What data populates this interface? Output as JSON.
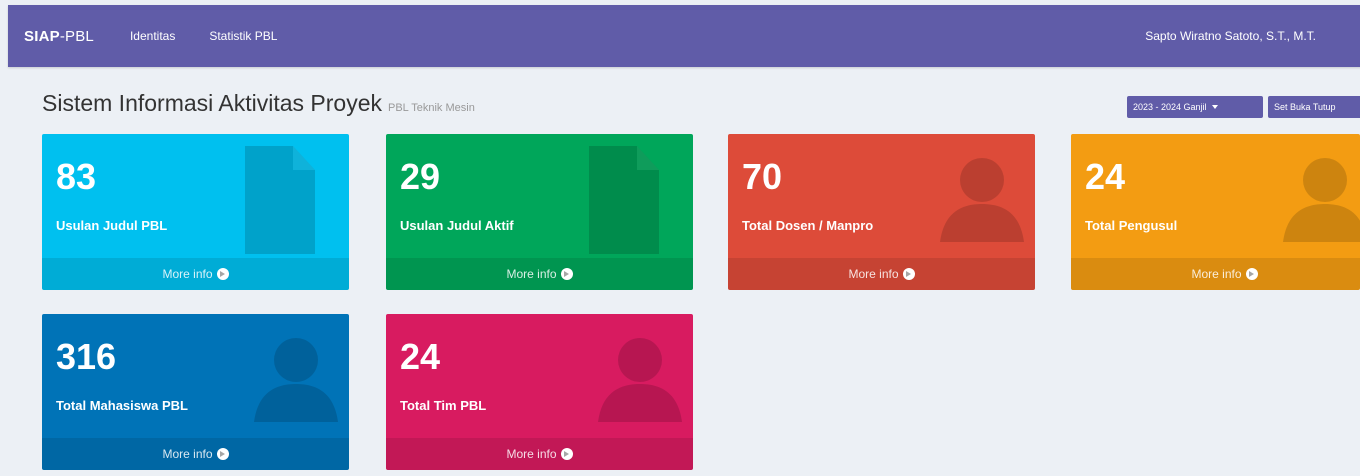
{
  "navbar": {
    "brand_bold": "SIAP",
    "brand_rest": "-PBL",
    "links": [
      "Identitas",
      "Statistik PBL"
    ],
    "user_name": "Sapto Wiratno Satoto, S.T., M.T."
  },
  "header": {
    "title": "Sistem Informasi Aktivitas Proyek",
    "subtitle": "PBL Teknik Mesin",
    "period_button": "2023 - 2024 Ganjil",
    "set_button": "Set Buka Tutup"
  },
  "boxes": [
    {
      "number": "83",
      "label": "Usulan Judul PBL",
      "more": "More info",
      "icon": "document-icon",
      "color": "#00c0ef"
    },
    {
      "number": "29",
      "label": "Usulan Judul Aktif",
      "more": "More info",
      "icon": "document-icon",
      "color": "#00a65a"
    },
    {
      "number": "70",
      "label": "Total Dosen / Manpro",
      "more": "More info",
      "icon": "user-icon",
      "color": "#dd4b39"
    },
    {
      "number": "24",
      "label": "Total Pengusul",
      "more": "More info",
      "icon": "user-icon",
      "color": "#f39c12"
    },
    {
      "number": "316",
      "label": "Total Mahasiswa PBL",
      "more": "More info",
      "icon": "user-icon",
      "color": "#0073b7"
    },
    {
      "number": "24",
      "label": "Total Tim PBL",
      "more": "More info",
      "icon": "user-icon",
      "color": "#d81b60"
    }
  ]
}
